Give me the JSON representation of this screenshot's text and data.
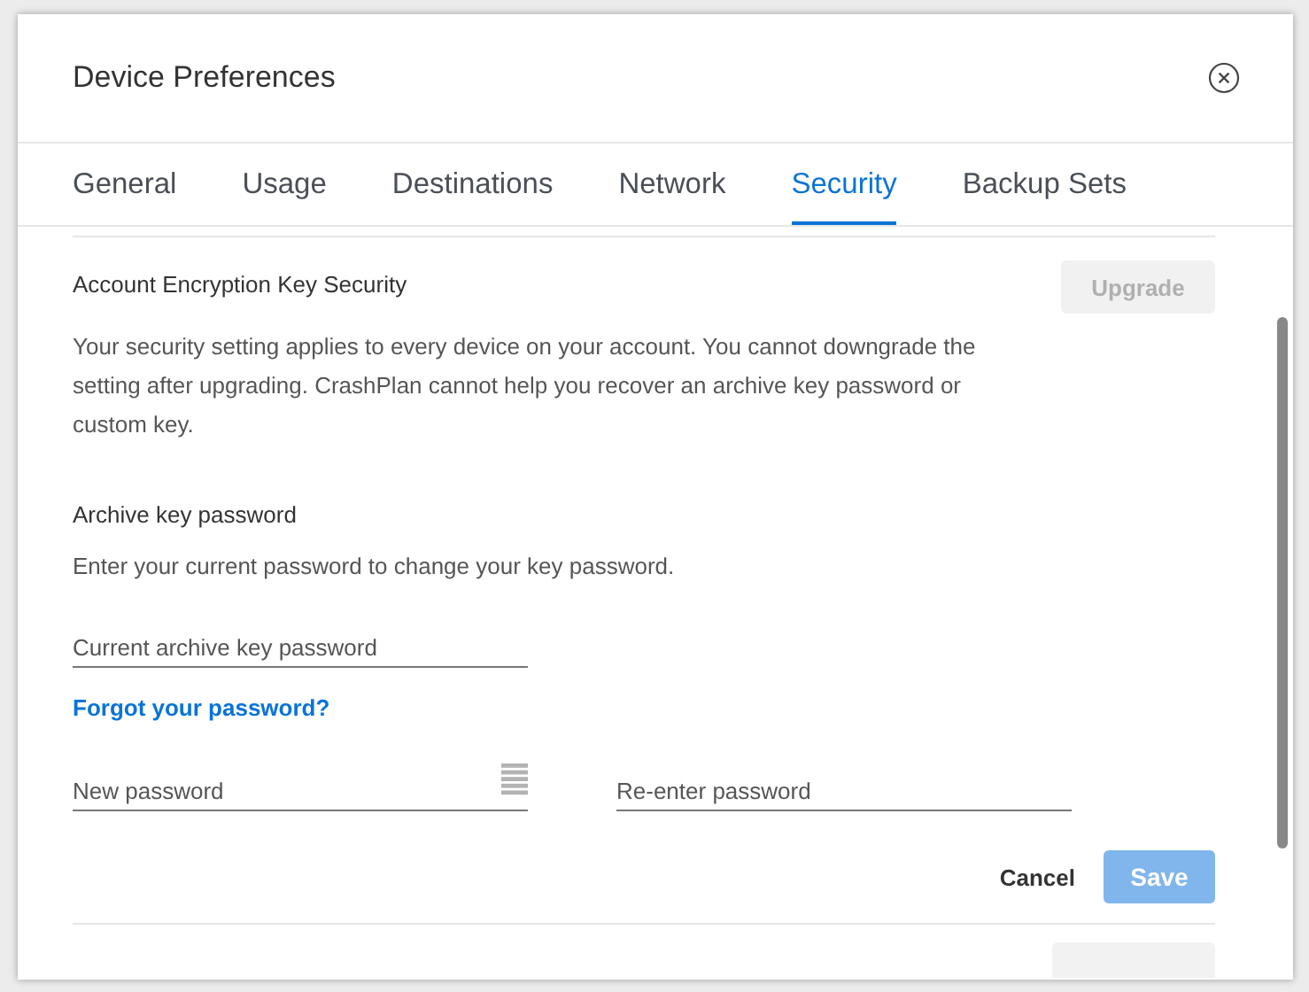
{
  "dialog": {
    "title": "Device Preferences"
  },
  "tabs": [
    {
      "label": "General",
      "selected": false
    },
    {
      "label": "Usage",
      "selected": false
    },
    {
      "label": "Destinations",
      "selected": false
    },
    {
      "label": "Network",
      "selected": false
    },
    {
      "label": "Security",
      "selected": true
    },
    {
      "label": "Backup Sets",
      "selected": false
    }
  ],
  "encryption": {
    "heading": "Account Encryption Key Security",
    "upgrade_button": {
      "label": "Upgrade",
      "disabled": true
    },
    "description": "Your security setting applies to every device on your account. You cannot downgrade the setting after upgrading. CrashPlan cannot help you recover an archive key password or custom key."
  },
  "archive_key": {
    "heading": "Archive key password",
    "description": "Enter your current password to change your key password.",
    "current_field": {
      "placeholder": "Current archive key password"
    },
    "forgot_link": "Forgot your password?",
    "new_field": {
      "placeholder": "New password"
    },
    "reenter_field": {
      "placeholder": "Re-enter password"
    },
    "cancel_button": {
      "label": "Cancel"
    },
    "save_button": {
      "label": "Save",
      "disabled": true
    }
  }
}
